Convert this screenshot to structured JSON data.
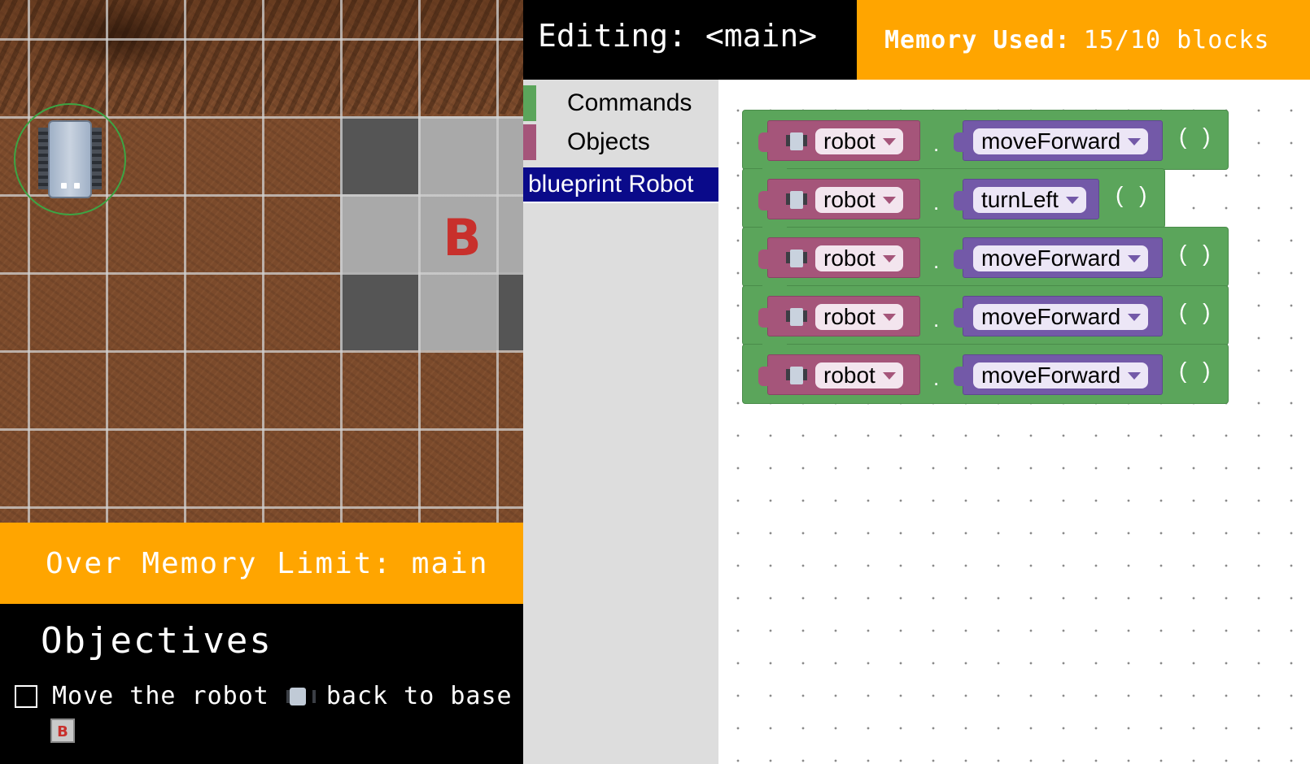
{
  "game": {
    "base_marker": "B"
  },
  "status_banner": {
    "text": "Over Memory Limit: main"
  },
  "objectives": {
    "title": "Objectives",
    "items": [
      {
        "checked": false,
        "text_before": "Move the robot",
        "text_after": "back to base",
        "base_icon_label": "B"
      }
    ]
  },
  "header": {
    "editing": "Editing: <main>",
    "memory_label": "Memory Used:",
    "memory_value": "15/10 blocks"
  },
  "toolbox": {
    "categories": [
      {
        "label": "Commands",
        "color": "#5ba55b"
      },
      {
        "label": "Objects",
        "color": "#a5557a"
      }
    ],
    "selected": "blueprint Robot"
  },
  "workspace": {
    "blocks": [
      {
        "object": "robot",
        "method": "moveForward",
        "args": "( )"
      },
      {
        "object": "robot",
        "method": "turnLeft",
        "args": "( )"
      },
      {
        "object": "robot",
        "method": "moveForward",
        "args": "( )"
      },
      {
        "object": "robot",
        "method": "moveForward",
        "args": "( )"
      },
      {
        "object": "robot",
        "method": "moveForward",
        "args": "( )"
      }
    ]
  },
  "colors": {
    "accent_orange": "#ffa500",
    "statement_green": "#5ba55b",
    "object_magenta": "#a5557a",
    "method_purple": "#7359a8",
    "toolbox_selected": "#0a0a8a"
  }
}
